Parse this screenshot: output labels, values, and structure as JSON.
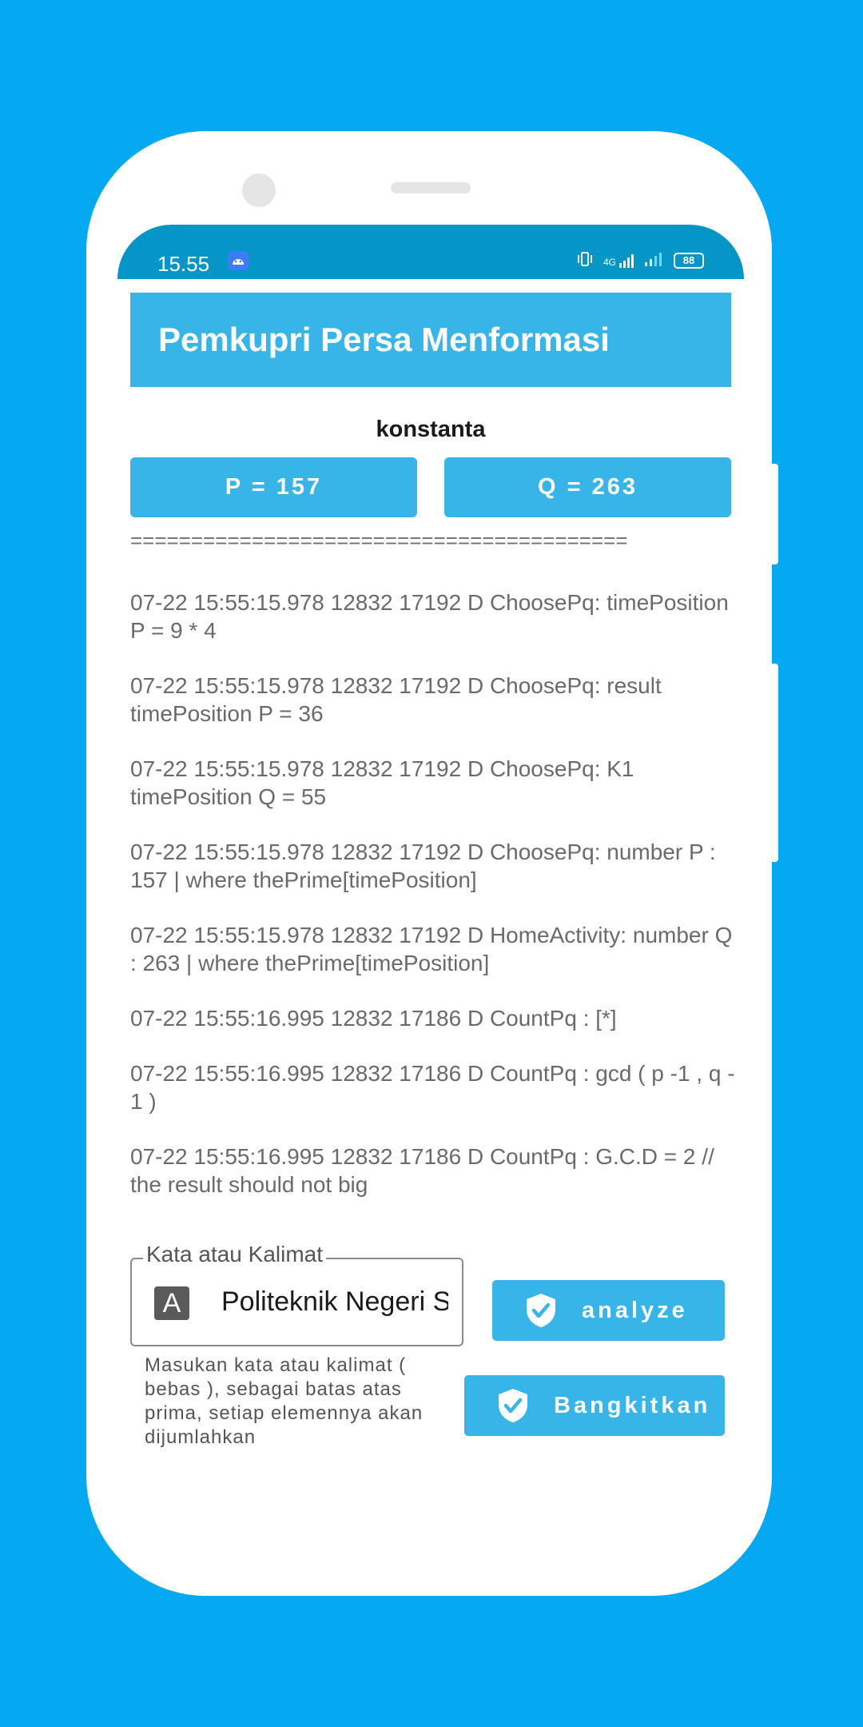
{
  "status": {
    "time": "15.55",
    "network": "4G",
    "battery": "88"
  },
  "app_title": "Pemkupri Persa Menformasi",
  "constants": {
    "heading": "konstanta",
    "p_label": "P = 157",
    "q_label": "Q = 263"
  },
  "divider": "=========================================",
  "log": [
    "07-22 15:55:15.978 12832 17192 D ChoosePq: timePosition P = 9 * 4",
    "07-22 15:55:15.978 12832 17192 D ChoosePq: result timePosition P = 36",
    "07-22 15:55:15.978 12832 17192 D ChoosePq: K1 timePosition Q =  55",
    "07-22 15:55:15.978 12832 17192 D ChoosePq: number P : 157 | where thePrime[timePosition]",
    "07-22 15:55:15.978 12832 17192 D HomeActivity: number Q : 263 | where thePrime[timePosition]",
    "07-22 15:55:16.995 12832 17186 D CountPq : [*]",
    "07-22 15:55:16.995 12832 17186 D CountPq : gcd ( p -1 , q - 1 )",
    "07-22 15:55:16.995 12832 17186 D CountPq : G.C.D = 2 // the result should not big"
  ],
  "input": {
    "label": "Kata atau Kalimat",
    "icon_letter": "A",
    "value": "Politeknik Negeri S",
    "hint": "Masukan kata atau kalimat ( bebas ), sebagai batas atas prima, setiap elemennya akan dijumlahkan"
  },
  "buttons": {
    "analyze": "analyze",
    "generate": "Bangkitkan"
  },
  "colors": {
    "background": "#05a9f1",
    "accent": "#37b5e8",
    "statusbar": "#0596c8"
  }
}
